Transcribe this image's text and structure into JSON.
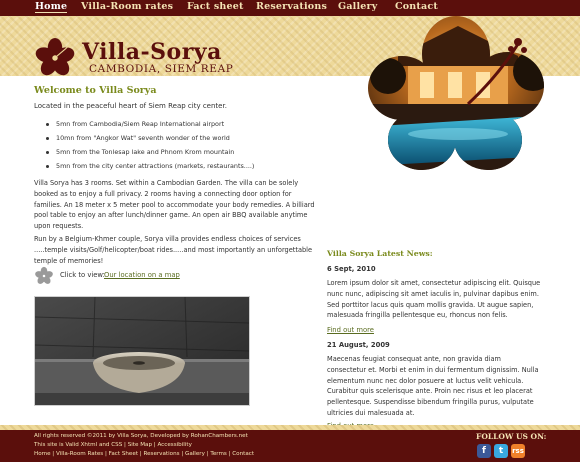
{
  "nav": {
    "items": [
      {
        "label": "Home",
        "active": true
      },
      {
        "label": "Villa-Room rates",
        "active": false
      },
      {
        "label": "Fact sheet",
        "active": false
      },
      {
        "label": "Reservations",
        "active": false
      },
      {
        "label": "Gallery",
        "active": false
      },
      {
        "label": "Contact",
        "active": false
      }
    ]
  },
  "header": {
    "logo_title": "Villa-Sorya",
    "logo_subtitle": "Cambodia, Siem Reap",
    "logo_icon": "hibiscus-flower-icon"
  },
  "main": {
    "welcome_title": "Welcome to Villa Sorya",
    "intro": "Located in the peaceful heart of Siem Reap city center.",
    "bullets": [
      "5mn from Cambodia/Siem Reap International airport",
      "10mn from \"Angkor Wat\" seventh wonder of the world",
      "5mn from the Tonlesap lake and Phnom Krom mountain",
      "5mn from the city center attractions (markets, restaurants....)"
    ],
    "para1": "Villa Sorya has 3 rooms. Set within a Cambodian Garden. The villa can be solely booked as to enjoy a full privacy. 2 rooms having a connecting door option for families. An 18 meter x 5 meter pool to accommodate your body remedies. A billiard pool table to enjoy an after lunch/dinner game. An open air BBQ available anytime upon requests.",
    "para2": "Run by a Belgium-Khmer couple, Sorya villa provides endless choices of services .....temple visits/Golf/helicopter/boat rides.....and most importantly an unforgettable temple of memories!",
    "map_label": "Click to view:",
    "map_link": "Our location on a map"
  },
  "news": {
    "title": "Villa Sorya Latest News:",
    "items": [
      {
        "date": "6 Sept, 2010",
        "text": "Lorem ipsum dolor sit amet, consectetur adipiscing elit. Quisque nunc nunc, adipiscing sit amet iaculis in, pulvinar dapibus enim. Sed porttitor lacus quis quam mollis gravida. Ut augue sapien, malesuada fringilla pellentesque eu, rhoncus non felis.",
        "link": "Find out more"
      },
      {
        "date": "21 August, 2009",
        "text": "Maecenas feugiat consequat ante, non gravida diam consectetur et. Morbi et enim in dui fermentum dignissim. Nulla elementum nunc nec dolor posuere at luctus velit vehicula. Curabitur quis scelerisque ante. Proin nec risus et leo placerat pellentesque. Suspendisse bibendum fringilla purus, vulputate ultricies dui malesuada at.",
        "link": "Find out more"
      }
    ]
  },
  "footer": {
    "line1": "All rights reserved ©2011 by Villa Sorya, Developed by RohanChambers.net",
    "line2": "This site is Valid Xhtml and CSS | Site Map | Accessibility",
    "line3": "Home | Villa-Room Rates | Fact Sheet | Reservations | Gallery | Terms | Contact",
    "follow_label": "Follow us on:",
    "social": [
      {
        "icon": "facebook-icon",
        "glyph": "f"
      },
      {
        "icon": "twitter-icon",
        "glyph": "t"
      },
      {
        "icon": "rss-icon",
        "glyph": "rss"
      }
    ]
  },
  "colors": {
    "maroon": "#5b0f0c",
    "olive": "#7a8a1c",
    "link": "#5a6c20",
    "bamboo": "#eed99a",
    "nav_text": "#f4e3b4"
  }
}
